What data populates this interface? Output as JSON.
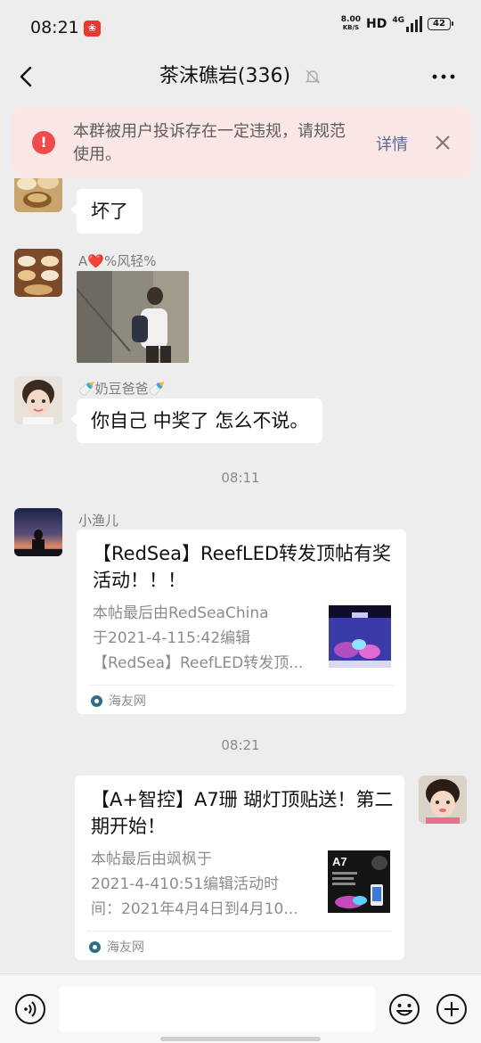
{
  "status_bar": {
    "time": "08:21",
    "net_speed_value": "8.00",
    "net_speed_unit": "KB/S",
    "hd_label": "HD",
    "network_type": "4G",
    "battery": "42"
  },
  "nav": {
    "title": "茶沫礁岩(336)"
  },
  "notice": {
    "text": "本群被用户投诉存在一定违规，请规范使用。",
    "detail_label": "详情"
  },
  "messages": {
    "m1": {
      "text": "坏了"
    },
    "m2": {
      "sender": "A❤️%风轻%"
    },
    "m3": {
      "sender": "🍼奶豆爸爸🍼",
      "text": "你自己 中奖了 怎么不说。"
    },
    "time1": "08:11",
    "m4": {
      "sender": "小渔儿",
      "title": "【RedSea】ReefLED转发顶帖有奖活动！！！",
      "desc_lines": [
        "本帖最后由RedSeaChina",
        "于2021-4-115:42编辑",
        "【RedSea】ReefLED转发顶..."
      ],
      "source": "海友网"
    },
    "time2": "08:21",
    "m5": {
      "title": "【A+智控】A7珊 瑚灯顶贴送！第二期开始！",
      "desc_lines": [
        "本帖最后由飒枫于",
        "2021-4-410:51编辑活动时",
        "间：2021年4月4日到4月10..."
      ],
      "thumb_label": "A7",
      "source": "海友网"
    }
  },
  "input": {
    "placeholder": ""
  },
  "colors": {
    "background": "#ededed",
    "notice_bg": "#fbe6e6",
    "notice_icon": "#f04a4a",
    "link": "#576b95",
    "bubble": "#ffffff"
  },
  "icons": [
    "back-arrow-icon",
    "bell-muted-icon",
    "more-icon",
    "info-icon",
    "close-icon",
    "voice-icon",
    "emoji-icon",
    "plus-icon",
    "source-logo-icon"
  ]
}
